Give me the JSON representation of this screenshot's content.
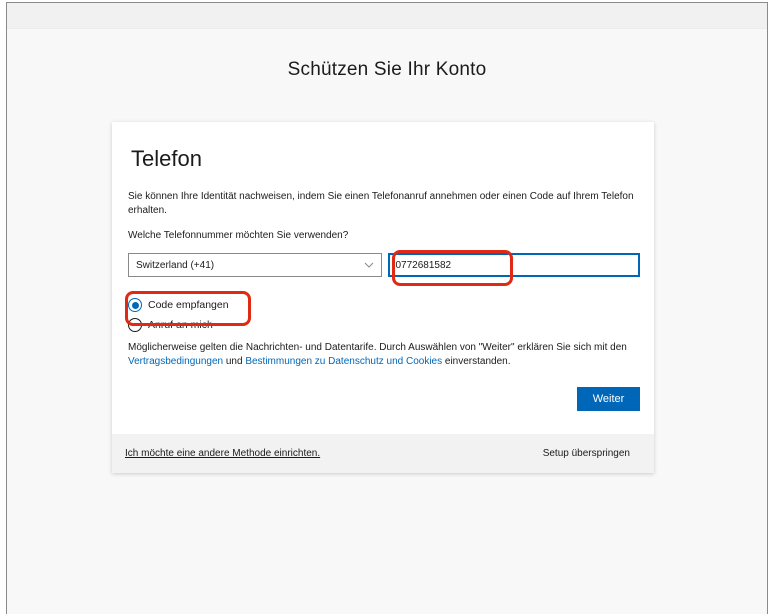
{
  "page": {
    "title": "Schützen Sie Ihr Konto"
  },
  "card": {
    "heading": "Telefon",
    "description": "Sie können Ihre Identität nachweisen, indem Sie einen Telefonanruf annehmen oder einen Code auf Ihrem Telefon erhalten.",
    "question": "Welche Telefonnummer möchten Sie verwenden?",
    "country_select": {
      "value": "Switzerland (+41)"
    },
    "phone_input": {
      "value": "0772681582"
    },
    "radio_options": [
      {
        "label": "Code empfangen",
        "selected": true
      },
      {
        "label": "Anruf an mich",
        "selected": false
      }
    ],
    "terms": {
      "prefix": "Möglicherweise gelten die Nachrichten- und Datentarife. Durch Auswählen von \"Weiter\" erklären Sie sich mit den ",
      "link1": "Vertragsbedingungen",
      "middle": " und ",
      "link2": "Bestimmungen zu Datenschutz und Cookies",
      "suffix": " einverstanden."
    },
    "next_button": "Weiter"
  },
  "footer": {
    "other_method_link": "Ich möchte eine andere Methode einrichten.",
    "skip_setup": "Setup überspringen"
  },
  "colors": {
    "accent": "#0067b8",
    "highlight": "#e02a14"
  }
}
